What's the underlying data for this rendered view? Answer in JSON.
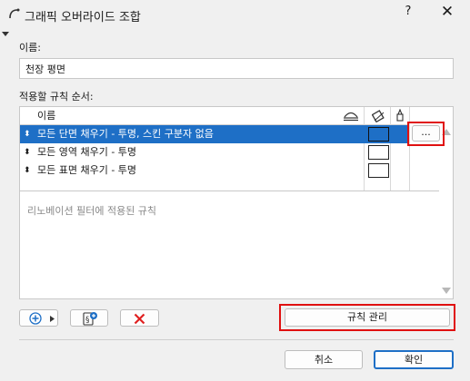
{
  "window": {
    "title": "그래픽 오버라이드 조합",
    "help_label": "?",
    "close_label": "✕"
  },
  "name_section": {
    "label": "이름:",
    "value": "천장 평면"
  },
  "rules_section": {
    "label": "적용할 규칙 순서:",
    "column_name": "이름",
    "rows": [
      {
        "label": "모든 단면 채우기 - 투명, 스킨 구분자 없음",
        "selected": true
      },
      {
        "label": "모든 영역 채우기 - 투명",
        "selected": false
      },
      {
        "label": "모든 표면 채우기 - 투명",
        "selected": false
      }
    ],
    "more_button_label": "...",
    "placeholder": "리노베이션 필터에 적용된 규칙"
  },
  "toolbar": {
    "manage_rules_label": "규칙 관리"
  },
  "footer": {
    "cancel_label": "취소",
    "ok_label": "확인"
  },
  "colors": {
    "accent": "#1e6fc6",
    "highlight": "#e01010",
    "delete": "#e02020"
  },
  "icons": [
    "app-icon",
    "add-rule-icon",
    "new-rule-icon",
    "delete-icon",
    "visibility-icon",
    "fill-icon",
    "pen-icon"
  ]
}
